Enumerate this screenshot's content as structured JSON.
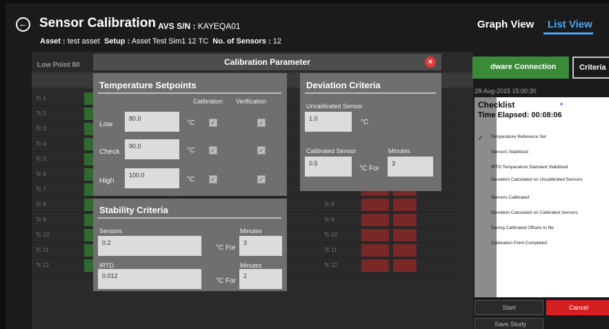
{
  "header": {
    "back_icon": "arrow-left-circle-icon",
    "title": "Sensor Calibration",
    "avs_label": "AVS S/N :",
    "avs_value": "KAYEQA01",
    "asset_label": "Asset :",
    "asset_value": "test asset",
    "setup_label": "Setup :",
    "setup_value": "Asset Test Sim1 12 TC",
    "sensors_label": "No. of Sensors :",
    "sensors_value": "12",
    "tab_graph": "Graph View",
    "tab_list": "List View",
    "active_tab_color": "#4aa6f0"
  },
  "background": {
    "low_point_label": "Low Point 80",
    "rows": [
      "Tc 1",
      "Tc 2",
      "Tc 3",
      "Tc 4",
      "Tc 5",
      "Tc 6",
      "Tc 7",
      "Tc 8",
      "Tc 9",
      "Tc 10",
      "Tc 11",
      "Tc 12"
    ]
  },
  "right_panel": {
    "hardware_button": "dware Connection",
    "criteria_button": "Criteria",
    "date": "28-Aug-2015 15:00:30",
    "checklist_title": "Checklist",
    "time_elapsed": "Time Elapsed: 00:08:06",
    "items": [
      "Temperature Reference Set",
      "Sensors Stabilized",
      "IRTD Temperature Standard Stabilized",
      "Deviation Calculated on Uncalibrated Sensors",
      "Sensors Calibrated",
      "Deviation Calculated on Calibrated Sensors",
      "Saving Calibrated Offsets to file",
      "Calibration Point Completed"
    ],
    "start_button": "Start",
    "cancel_button": "Cancel",
    "save_button": "Save Study",
    "cancel_color": "#d62020",
    "hardware_color": "#3a8a38"
  },
  "modal": {
    "title": "Calibration Parameter",
    "close_icon": "close-icon",
    "setpoints": {
      "title": "Temperature Setpoints",
      "col_calibration": "Calibration",
      "col_verification": "Verification",
      "rows": [
        {
          "label": "Low",
          "value": "80.0",
          "unit": "°C"
        },
        {
          "label": "Check",
          "value": "90.0",
          "unit": "°C"
        },
        {
          "label": "High",
          "value": "100.0",
          "unit": "°C"
        }
      ]
    },
    "deviation": {
      "title": "Deviation Criteria",
      "uncal_label": "Uncalibrated Sensor",
      "uncal_value": "1.0",
      "uncal_unit": "°C",
      "cal_label": "Calibrated Sensor",
      "cal_value": "0.5",
      "cal_unit": "°C For",
      "minutes_label": "Minutes",
      "minutes_value": "3"
    },
    "stability": {
      "title": "Stability Criteria",
      "sensors_label": "Sensors",
      "sensors_value": "0.2",
      "sensors_unit": "°C For",
      "sensors_minutes_label": "Minutes",
      "sensors_minutes_value": "3",
      "irtd_label": "IRTD",
      "irtd_value": "0.012",
      "irtd_unit": "°C For",
      "irtd_minutes_label": "Minutes",
      "irtd_minutes_value": "2"
    }
  }
}
